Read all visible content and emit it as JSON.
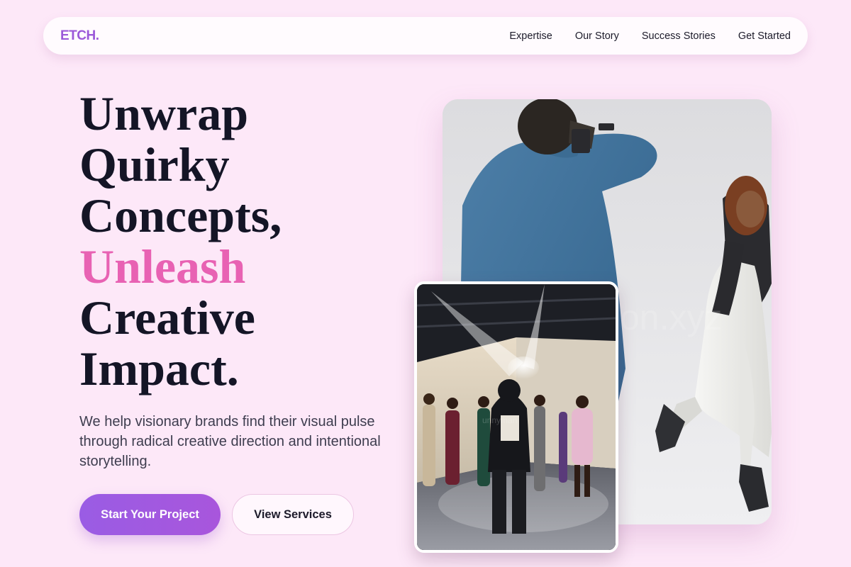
{
  "nav": {
    "logo": "ETCH.",
    "links": [
      "Expertise",
      "Our Story",
      "Success Stories",
      "Get Started"
    ]
  },
  "hero": {
    "headline": {
      "line1": "Unwrap",
      "line2": "Quirky",
      "line3": "Concepts,",
      "accent": "Unleash",
      "line5": "Creative",
      "line6": "Impact."
    },
    "subtext": "We help visionary brands find their visual pulse through radical creative direction and intentional storytelling.",
    "primary_cta": "Start Your Project",
    "secondary_cta": "View Services"
  },
  "images": {
    "main": "photographer-and-model-photo",
    "secondary": "fashion-show-backstage-photo"
  },
  "colors": {
    "background": "#fde8f8",
    "brand": "#9b59d9",
    "accent": "#e862b3",
    "text": "#141526"
  }
}
